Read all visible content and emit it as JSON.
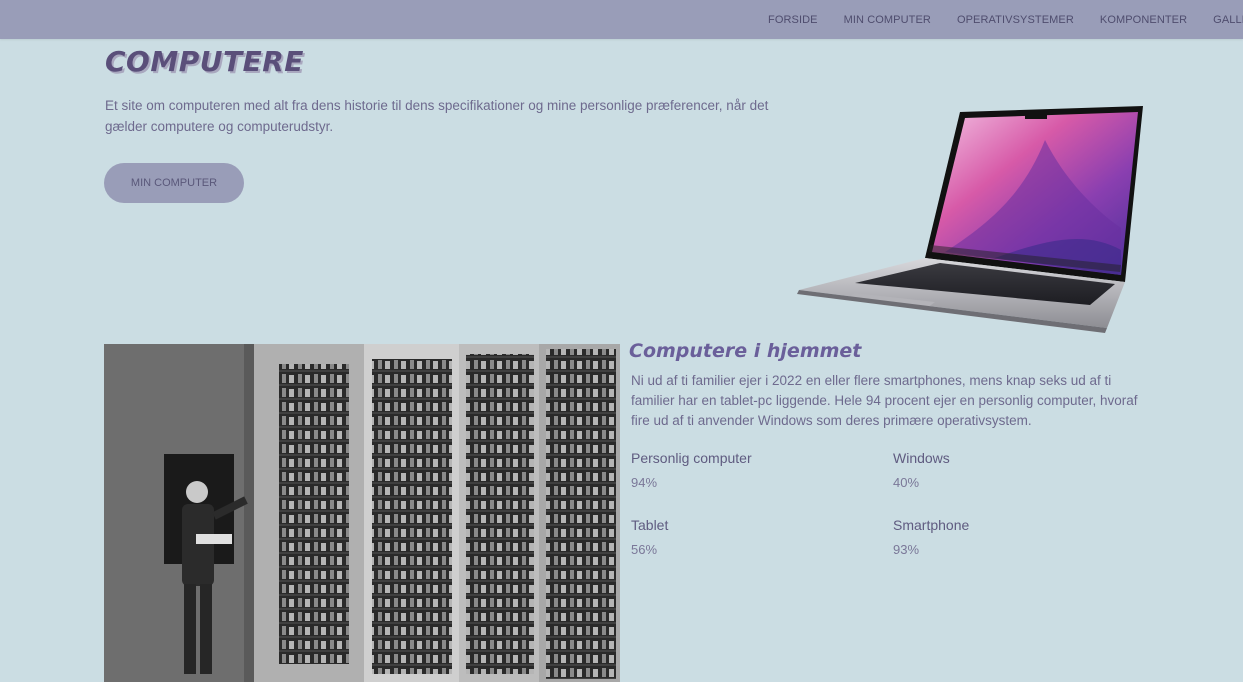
{
  "nav": {
    "items": [
      "FORSIDE",
      "MIN COMPUTER",
      "OPERATIVSYSTEMER",
      "KOMPONENTER",
      "GALLERI"
    ]
  },
  "hero": {
    "title": "COMPUTERE",
    "text": "Et site om computeren med alt fra dens historie til dens specifikationer og mine personlige præferencer, når det gælder computere og computerudstyr.",
    "button_label": "MIN COMPUTER"
  },
  "section": {
    "title": "Computere i hjemmet",
    "text": "Ni ud af ti familier ejer i 2022 en eller flere smartphones, mens knap seks ud af ti familier har en tablet-pc liggende. Hele 94 procent ejer en personlig computer, hvoraf fire ud af ti anvender Windows som deres primære operativsystem.",
    "stats": [
      {
        "label": "Personlig computer",
        "value": "94%"
      },
      {
        "label": "Windows",
        "value": "40%"
      },
      {
        "label": "Tablet",
        "value": "56%"
      },
      {
        "label": "Smartphone",
        "value": "93%"
      }
    ]
  },
  "colors": {
    "background": "#cbdde3",
    "nav_bg": "#999db8",
    "accent": "#6a5f9a",
    "text": "#6e6a8e"
  }
}
